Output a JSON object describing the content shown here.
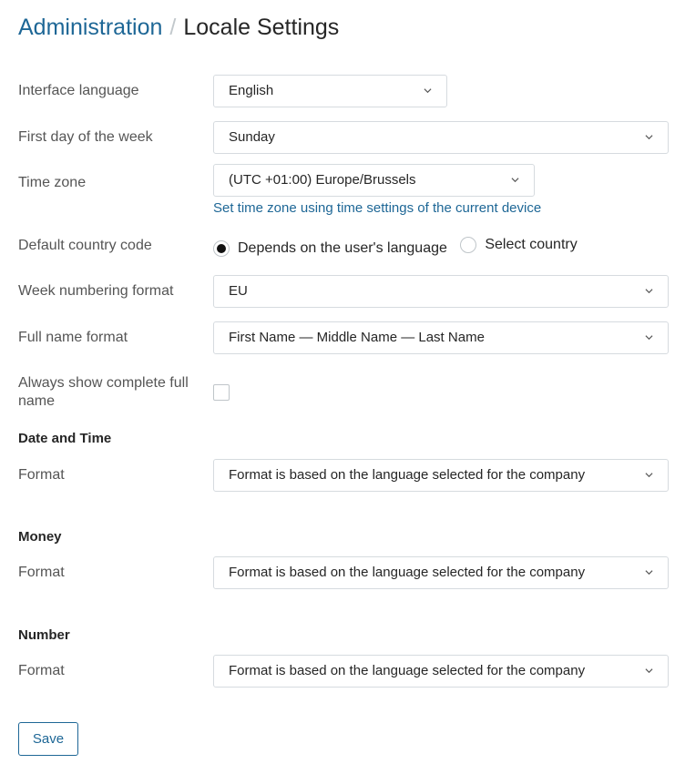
{
  "header": {
    "breadcrumb_root": "Administration",
    "separator": "/",
    "title": "Locale Settings"
  },
  "fields": {
    "interface_language": {
      "label": "Interface language",
      "value": "English"
    },
    "first_day": {
      "label": "First day of the week",
      "value": "Sunday"
    },
    "time_zone": {
      "label": "Time zone",
      "value": "(UTC +01:00) Europe/Brussels",
      "link": "Set time zone using time settings of the current device"
    },
    "country_code": {
      "label": "Default country code",
      "options": [
        {
          "label": "Depends on the user's language",
          "selected": true
        },
        {
          "label": "Select country",
          "selected": false
        }
      ]
    },
    "week_numbering": {
      "label": "Week numbering format",
      "value": "EU"
    },
    "full_name_format": {
      "label": "Full name format",
      "value": "First Name — Middle Name — Last Name"
    },
    "always_show_full_name": {
      "label": "Always show complete full name",
      "checked": false
    }
  },
  "sections": {
    "date_time": {
      "heading": "Date and Time",
      "format_label": "Format",
      "value": "Format is based on the language selected for the company"
    },
    "money": {
      "heading": "Money",
      "format_label": "Format",
      "value": "Format is based on the language selected for the company"
    },
    "number": {
      "heading": "Number",
      "format_label": "Format",
      "value": "Format is based on the language selected for the company"
    }
  },
  "actions": {
    "save_label": "Save"
  },
  "colors": {
    "accent": "#1e6796",
    "border": "#d6dbdf",
    "text": "#262626",
    "label": "#555555"
  },
  "icons": {
    "dropdown": "chevron-down-icon"
  }
}
